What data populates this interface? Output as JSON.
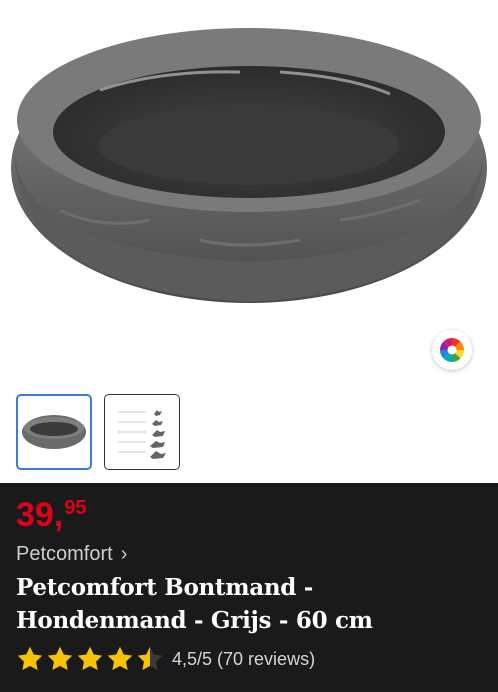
{
  "product": {
    "price_main": "39,",
    "price_cents": "95",
    "brand": "Petcomfort",
    "title_line1": "Petcomfort Bontmand -",
    "title_line2": "Hondenmand - Grijs - 60 cm",
    "rating": {
      "value": 4.5,
      "max": 5,
      "text": "4,5/5 (70 reviews)"
    }
  },
  "gallery": {
    "main_image": "grey-plush-dog-basket",
    "thumbnails": [
      {
        "name": "grey-plush-dog-basket",
        "selected": true
      },
      {
        "name": "size-chart-dog-silhouettes",
        "selected": false
      }
    ]
  },
  "colors": {
    "price": "#e0001b",
    "info_bg": "#1a1a1a",
    "star": "#f5c400",
    "selected_border": "#3b7dd8"
  }
}
